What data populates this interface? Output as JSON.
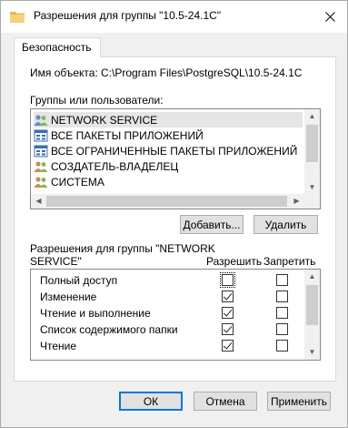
{
  "window": {
    "title": "Разрешения для группы \"10.5-24.1C\""
  },
  "tabs": [
    {
      "label": "Безопасность"
    }
  ],
  "object": {
    "label": "Имя объекта:",
    "value": "C:\\Program Files\\PostgreSQL\\10.5-24.1C"
  },
  "groups": {
    "label": "Группы или пользователи:",
    "items": [
      {
        "label": "NETWORK SERVICE",
        "icon": "users-icon",
        "selected": true
      },
      {
        "label": "ВСЕ ПАКЕТЫ ПРИЛОЖЕНИЙ",
        "icon": "app-package-icon",
        "selected": false
      },
      {
        "label": "ВСЕ ОГРАНИЧЕННЫЕ ПАКЕТЫ ПРИЛОЖЕНИЙ",
        "icon": "app-package-icon",
        "selected": false
      },
      {
        "label": "СОЗДАТЕЛЬ-ВЛАДЕЛЕЦ",
        "icon": "users-icon",
        "selected": false
      },
      {
        "label": "СИСТЕМА",
        "icon": "users-icon",
        "selected": false
      }
    ]
  },
  "buttons": {
    "add": "Добавить...",
    "remove": "Удалить",
    "ok": "ОК",
    "cancel": "Отмена",
    "apply": "Применить"
  },
  "permissions": {
    "label_line1": "Разрешения для группы \"NETWORK",
    "label_line2": "SERVICE\"",
    "allow_header": "Разрешить",
    "deny_header": "Запретить",
    "rows": [
      {
        "name": "Полный доступ",
        "allow": false,
        "deny": false
      },
      {
        "name": "Изменение",
        "allow": true,
        "deny": false
      },
      {
        "name": "Чтение и выполнение",
        "allow": true,
        "deny": false
      },
      {
        "name": "Список содержимого папки",
        "allow": true,
        "deny": false
      },
      {
        "name": "Чтение",
        "allow": true,
        "deny": false
      }
    ]
  },
  "colors": {
    "accent": "#0078d7",
    "selection": "#e5e5e5",
    "window_bg": "#f0f0f0"
  }
}
